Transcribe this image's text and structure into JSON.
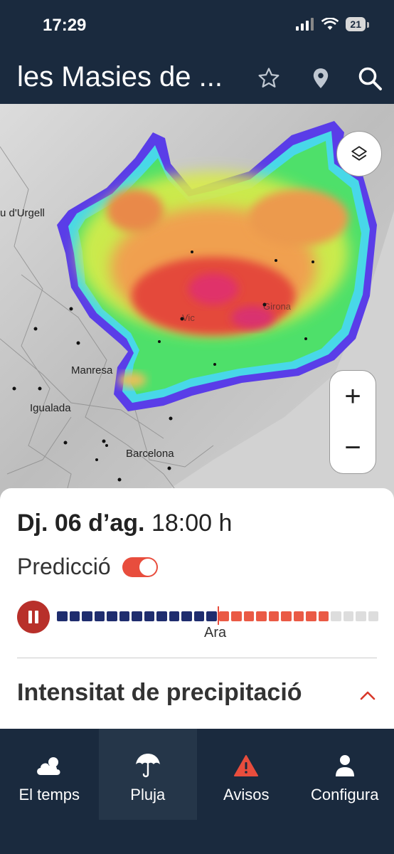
{
  "status_bar": {
    "time": "17:29",
    "battery": "21"
  },
  "header": {
    "title": "les Masies de ...",
    "icons": [
      "star-icon",
      "location-pin-icon",
      "search-icon"
    ]
  },
  "map": {
    "labels": {
      "urgell": "u d'Urgell",
      "manresa": "Manresa",
      "igualada": "Igualada",
      "barcelona": "Barcelona",
      "vic": "Vic",
      "girona": "Girona"
    },
    "controls": {
      "zoom_in": "+",
      "zoom_out": "−",
      "layers_icon": "layers-icon"
    }
  },
  "panel": {
    "day": "Dj. 06 d’ag.",
    "time": "18:00 h",
    "prediction_label": "Predicció",
    "prediction_enabled": true,
    "timeline": {
      "past_segments": 13,
      "future_segments": 9,
      "remaining_segments": 4,
      "now_label": "Ara"
    },
    "intensity_title": "Intensitat de precipitació"
  },
  "colors": {
    "header_bg": "#1a2a3e",
    "accent_red": "#e84d3d",
    "past_blue": "#1f2d6e",
    "future_red": "#ea5a45",
    "remaining_gray": "#dddddd"
  },
  "tabs": [
    {
      "label": "El temps",
      "icon": "cloud-icon"
    },
    {
      "label": "Pluja",
      "icon": "umbrella-icon"
    },
    {
      "label": "Avisos",
      "icon": "warning-icon"
    },
    {
      "label": "Configura",
      "icon": "user-icon"
    }
  ],
  "active_tab": "Pluja"
}
